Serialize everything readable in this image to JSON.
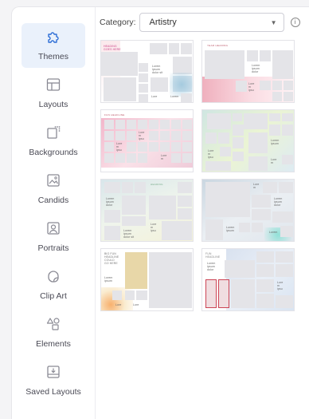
{
  "sidebar": {
    "items": [
      {
        "label": "Themes",
        "icon": "puzzle-icon",
        "active": true
      },
      {
        "label": "Layouts",
        "icon": "layout-icon"
      },
      {
        "label": "Backgrounds",
        "icon": "background-icon"
      },
      {
        "label": "Candids",
        "icon": "candid-photo-icon"
      },
      {
        "label": "Portraits",
        "icon": "portrait-icon"
      },
      {
        "label": "Clip Art",
        "icon": "clip-art-icon"
      },
      {
        "label": "Elements",
        "icon": "shapes-icon"
      },
      {
        "label": "Saved Layouts",
        "icon": "saved-layout-icon"
      }
    ]
  },
  "category": {
    "label": "Category:",
    "selected": "Artistry"
  },
  "colors": {
    "active_bg": "#eaf1fb",
    "icon_blue": "#2f6fd6",
    "icon_gray": "#8a8a94"
  },
  "thumbnails": {
    "t1": {
      "head": "HEADING\nGOES HERE",
      "text1": "Lorem\nipsum\ndolor sit",
      "text2": "Lore",
      "text3": "Lorem"
    },
    "t2": {
      "head": "YEAR HEADING",
      "text1": "Lorem\nipsum\ndolor",
      "text2": "Lore\nm\nipsu"
    },
    "t3": {
      "head": "FUN HEADLINE",
      "text1": "Lore\nm\nipsu",
      "text2": "Lore\nm\nipsu",
      "text3": "Lore\nm"
    },
    "t4": {
      "text1": "Lore\nm\nipsu",
      "text2": "Lorem\nipsum",
      "text3": "Lore\nm"
    },
    "t5": {
      "head": "HEADING",
      "text1": "Lorem\nipsum\ndolor",
      "text2": "Lorem\nipsum\ndolor sit",
      "text3": "Lore\nm\nipsu"
    },
    "t6": {
      "text1": "Lore\nm",
      "text2": "Lorem\nipsum\ndolor",
      "text3": "Lorem\nipsum",
      "text4": "Lorem"
    },
    "t7": {
      "head": "BIG FUN\nHEADLINE\nCOULD\nGO HERE",
      "text1": "Lorem\nipsum",
      "text2": "Lore",
      "text3": "Lore"
    },
    "t8": {
      "head": "FUN\nHEADLINE",
      "text1": "Lorem\nipsum\ndolor",
      "text2": "Lore\nm\nipsu"
    }
  }
}
